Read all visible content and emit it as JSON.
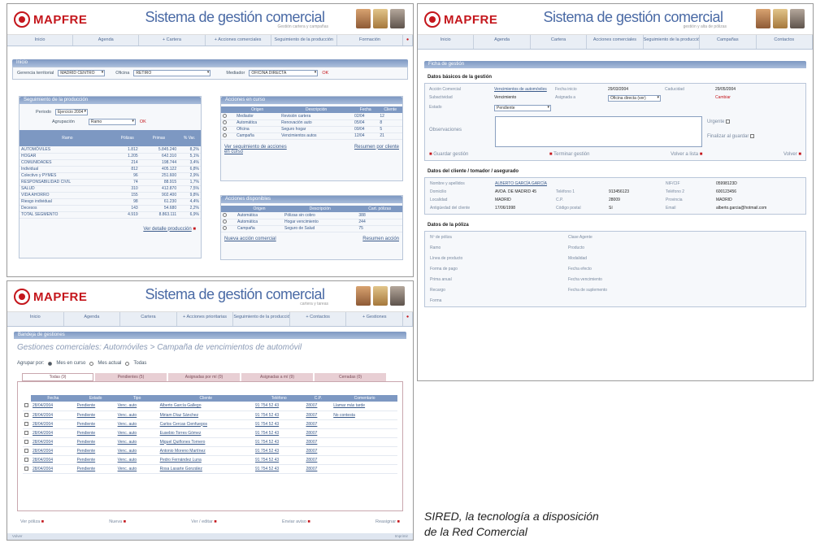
{
  "app": {
    "logo_text": "MAPFRE",
    "title": "Sistema de gestión comercial",
    "subtitle": "Gestión cartera y campañas",
    "subtitle_s2": "gestión y alta de pólizas",
    "subtitle_s3": "cartera y tareas"
  },
  "nav": {
    "s1": [
      "Inicio",
      "Agenda",
      "+ Cartera",
      "+ Acciones comerciales",
      "Seguimiento de la producción",
      "Formación",
      "Noticias"
    ],
    "s2": [
      "Inicio",
      "Agenda",
      "Cartera",
      "Acciones comerciales",
      "Seguimiento de la producción",
      "Campañas",
      "Contactos"
    ],
    "s3": [
      "Inicio",
      "Agenda",
      "Cartera",
      "+ Acciones prioritarias",
      "Seguimiento de la producción",
      "+ Contactos",
      "+ Gestiones"
    ]
  },
  "s1": {
    "inicio_bar": "Inicio",
    "filters": {
      "comercial_label": "Gerencia territorial",
      "comercial_value": "MADRID CENTRO",
      "oficina_label": "Oficina",
      "oficina_value": "RETIRO",
      "oficina2_label": "Mediador",
      "oficina2_value": "OFICINA DIRECTA",
      "ok": "OK"
    },
    "seguimiento": {
      "title": "Seguimiento de la producción",
      "periodo_label": "Periodo",
      "periodo_value": "Ejercicio 2004",
      "agrupar_label": "Agrupación",
      "agrupar_value": "Ramo",
      "ok": "OK",
      "headers": [
        "Ramo",
        "Pólizas",
        "Primas",
        "% Var."
      ],
      "rows": [
        [
          "AUTOMÓVILES",
          "1.812",
          "5.845.240",
          "8,2%"
        ],
        [
          "HOGAR",
          "1.205",
          "642.310",
          "5,1%"
        ],
        [
          "COMUNIDADES",
          "214",
          "198.744",
          "3,4%"
        ],
        [
          "Individual",
          "812",
          "405.122",
          "6,8%"
        ],
        [
          "Colectivo y PYMES",
          "96",
          "251.600",
          "2,9%"
        ],
        [
          "RESPONSABILIDAD CIVIL",
          "74",
          "88.915",
          "1,7%"
        ],
        [
          "SALUD",
          "310",
          "412.870",
          "7,5%"
        ],
        [
          "VIDA AHORRO",
          "155",
          "902.400",
          "9,8%"
        ],
        [
          "Riesgo individual",
          "98",
          "61.230",
          "4,4%"
        ],
        [
          "Decesos",
          "143",
          "54.680",
          "2,2%"
        ],
        [
          "TOTAL SEGMENTO",
          "4.919",
          "8.863.111",
          "6,9%"
        ]
      ],
      "link": "Ver detalle producción"
    },
    "acciones_curso": {
      "title": "Acciones en curso",
      "headers": [
        "",
        "Origen",
        "Descripción",
        "Fecha",
        "Cliente"
      ],
      "rows": [
        [
          "Mediador",
          "Revisión cartera",
          "02/04",
          "12"
        ],
        [
          "Automática",
          "Renovación auto",
          "05/04",
          "8"
        ],
        [
          "Oficina",
          "Seguro hogar",
          "09/04",
          "5"
        ],
        [
          "Campaña",
          "Vencimientos autos",
          "12/04",
          "21"
        ]
      ],
      "link1": "Ver seguimiento de acciones en curso",
      "link2": "Resumen por cliente"
    },
    "acciones_disp": {
      "title": "Acciones disponibles",
      "headers": [
        "",
        "Origen",
        "Descripción",
        "Cart. pólizas"
      ],
      "rows": [
        [
          "Automática",
          "Pólizas sin cobro",
          "388"
        ],
        [
          "Automática",
          "Hogar vencimiento",
          "244"
        ],
        [
          "Campaña",
          "Seguro de Salud",
          "75"
        ]
      ],
      "link1": "Nueva acción comercial",
      "link2": "Resumen acción"
    }
  },
  "s2": {
    "bar": "Ficha de gestión",
    "sec1": "Datos básicos de la gestión",
    "f": [
      [
        "Acción Comercial",
        "Vencimientos de automóviles",
        "Fecha inicio",
        "29/03/2004",
        "Caducidad",
        "29/05/2004"
      ],
      [
        "Subactividad",
        "Vencimiento",
        "Asignada a",
        "Oficina directa (ver)",
        "",
        "Cambiar"
      ],
      [
        "Estado",
        "Pendiente",
        "",
        "",
        "",
        ""
      ]
    ],
    "obs_label": "Observaciones",
    "urgente_label": "Urgente",
    "finalizar_label": "Finalizar al guardar",
    "actions": [
      "Guardar gestión",
      "Terminar gestión",
      "Volver a lista",
      "Volver"
    ],
    "sec2": "Datos del cliente / tomador / asegurado",
    "c": [
      [
        "Nombre y apellidos",
        "ALBERTO GARCÍA GARCÍA",
        "",
        "",
        "NIF/CIF",
        "05998123D"
      ],
      [
        "Domicilio",
        "AVDA. DE MADRID 45",
        "Teléfono 1",
        "913456123",
        "Teléfono 2",
        "600123456"
      ],
      [
        "Localidad",
        "MADRID",
        "C.P.",
        "28009",
        "Provincia",
        "MADRID"
      ],
      [
        "Antigüedad del cliente",
        "17/06/1998",
        "Código postal",
        "Sí",
        "Email",
        "alberto.garcia@hotmail.com"
      ]
    ],
    "sec3": "Datos de la póliza",
    "p": [
      [
        "Nº de póliza",
        "Clase Agente"
      ],
      [
        "Ramo",
        "Producto"
      ],
      [
        "Línea de producto",
        "Modalidad"
      ],
      [
        "Forma de pago",
        "Fecha efecto"
      ],
      [
        "Prima anual",
        "Fecha vencimiento"
      ],
      [
        "Recargo",
        "Fecha de suplemento"
      ],
      [
        "Forma",
        ""
      ]
    ]
  },
  "s3": {
    "bar": "Bandeja de gestiones",
    "breadcrumb": "Gestiones comerciales: Automóviles > Campaña de vencimientos de automóvil",
    "agrupar_label": "Agrupar por:",
    "agrupar_opts": [
      "Mes en curso",
      "Mes actual",
      "Todas"
    ],
    "tabs": [
      "Todas (9)",
      "Pendientes (5)",
      "Asignadas por mí (0)",
      "Asignadas a mí (9)",
      "Cerradas (0)"
    ],
    "headers": [
      "Fecha",
      "Estado",
      "Tipo",
      "Cliente",
      "Teléfono",
      "C.P.",
      "Comentario"
    ],
    "rows": [
      [
        "28/04/2004",
        "Pendiente",
        "Venc. auto",
        "Alberto García Gallego",
        "91 754 52 43",
        "28007",
        "Llamar más tarde"
      ],
      [
        "28/04/2004",
        "Pendiente",
        "Venc. auto",
        "Miriam Díaz Sánchez",
        "91 754 52 43",
        "28007",
        "No contesta"
      ],
      [
        "28/04/2004",
        "Pendiente",
        "Venc. auto",
        "Carlos Cercas Cienfuegos",
        "91 754 52 43",
        "28007",
        ""
      ],
      [
        "28/04/2004",
        "Pendiente",
        "Venc. auto",
        "Eusebio Torres Gómez",
        "91 754 52 43",
        "28007",
        ""
      ],
      [
        "28/04/2004",
        "Pendiente",
        "Venc. auto",
        "Miguel Quiñones Tornero",
        "91 754 52 43",
        "28007",
        ""
      ],
      [
        "28/04/2004",
        "Pendiente",
        "Venc. auto",
        "Antonio Moreno Martínez",
        "91 754 52 43",
        "28007",
        ""
      ],
      [
        "28/04/2004",
        "Pendiente",
        "Venc. auto",
        "Pedro Fernández Luna",
        "91 754 52 43",
        "28007",
        ""
      ],
      [
        "28/04/2004",
        "Pendiente",
        "Venc. auto",
        "Rosa Lasarte González",
        "91 754 52 43",
        "28007",
        ""
      ]
    ],
    "bottom": [
      "Ver póliza",
      "Nueva",
      "Ver / editar",
      "Enviar aviso",
      "Reasignar"
    ],
    "foot_left": "Volver",
    "foot_right": "Imprimir"
  },
  "caption": {
    "line1": "SIRED, la tecnología a disposición",
    "line2": "de la Red Comercial"
  }
}
